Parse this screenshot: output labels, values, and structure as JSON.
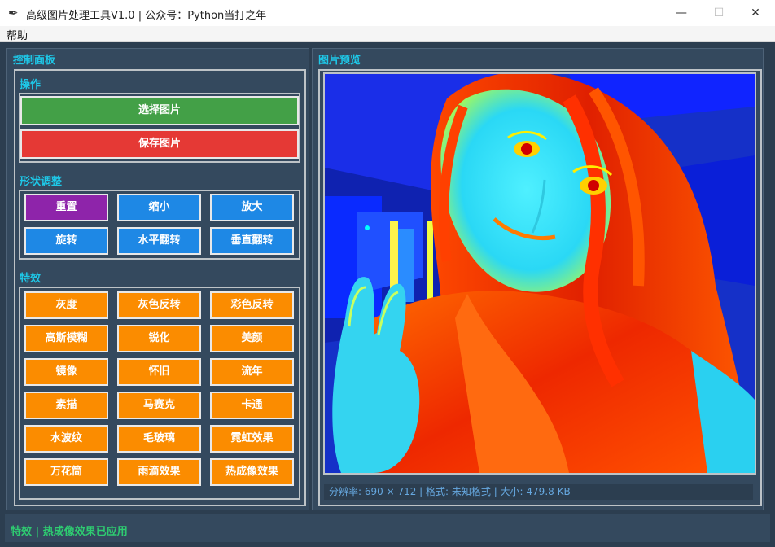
{
  "window": {
    "title": "高级图片处理工具V1.0 | 公众号：Python当打之年",
    "minimize": "—",
    "maximize": "☐",
    "close": "✕",
    "icon": "feather-icon"
  },
  "menu": {
    "help": "帮助"
  },
  "control_panel": {
    "title": "控制面板",
    "operations": {
      "title": "操作",
      "select_image": "选择图片",
      "save_image": "保存图片"
    },
    "shape_adjust": {
      "title": "形状调整",
      "buttons": [
        "重置",
        "缩小",
        "放大",
        "旋转",
        "水平翻转",
        "垂直翻转"
      ]
    },
    "effects": {
      "title": "特效",
      "buttons": [
        "灰度",
        "灰色反转",
        "彩色反转",
        "高斯模糊",
        "锐化",
        "美颜",
        "镜像",
        "怀旧",
        "流年",
        "素描",
        "马赛克",
        "卡通",
        "水波纹",
        "毛玻璃",
        "霓虹效果",
        "万花筒",
        "雨滴效果",
        "热成像效果"
      ]
    }
  },
  "preview": {
    "title": "图片预览",
    "info": "分辨率: 690 × 712 | 格式: 未知格式 | 大小: 479.8 KB"
  },
  "status": {
    "text": "特效 | 热成像效果已应用"
  },
  "colors": {
    "background": "#2c3e50",
    "panel": "#34495e",
    "title_accent": "#1ec8e8",
    "select_button": "#43a047",
    "save_button": "#e53935",
    "reset_button": "#8e24aa",
    "shape_button": "#1e88e5",
    "effect_button": "#fb8c00",
    "status_text": "#2ecc71"
  }
}
